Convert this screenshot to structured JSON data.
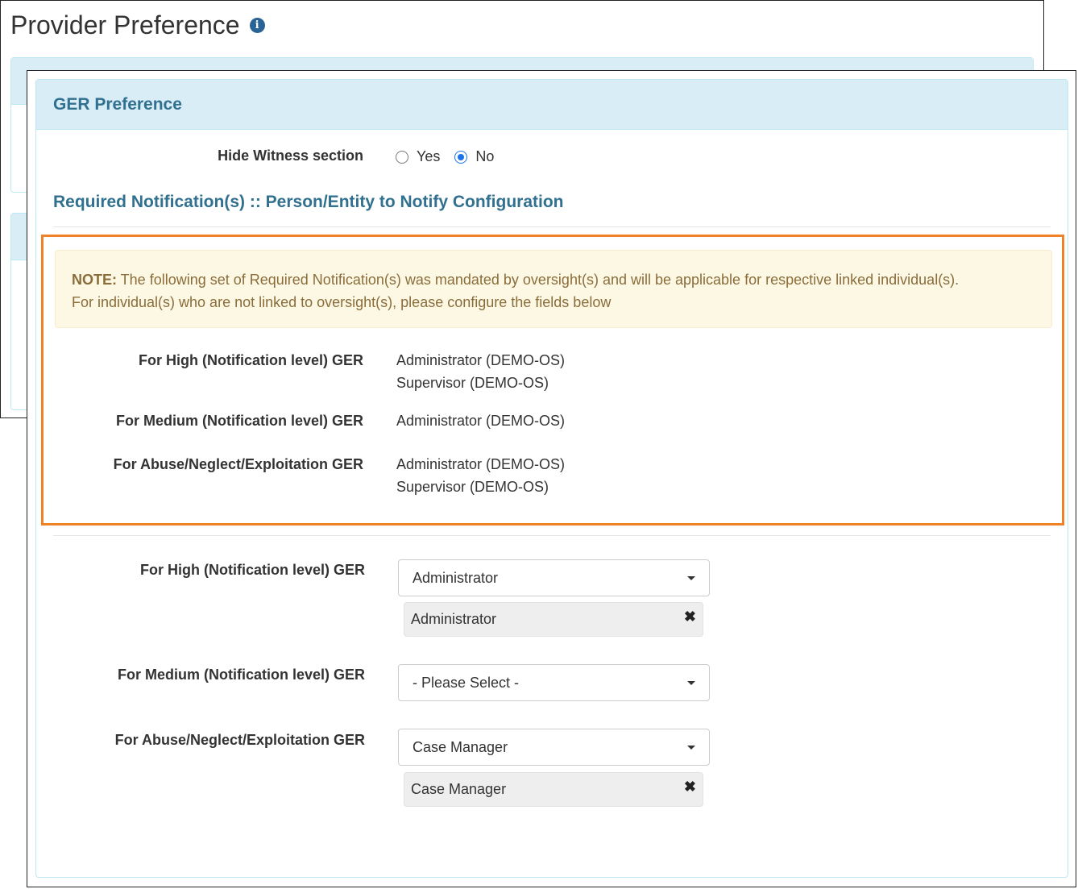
{
  "background": {
    "title": "Provider Preference"
  },
  "panel": {
    "title": "GER Preference"
  },
  "hide_witness": {
    "label": "Hide Witness section",
    "options": [
      "Yes",
      "No"
    ],
    "selected": "No"
  },
  "section_title": "Required Notification(s) :: Person/Entity to Notify Configuration",
  "note": {
    "prefix": "NOTE:",
    "line1": " The following set of Required Notification(s) was mandated by oversight(s) and will be applicable for respective linked individual(s).",
    "line2": "For individual(s) who are not linked to oversight(s), please configure the fields below"
  },
  "mandated": [
    {
      "label": "For High (Notification level) GER",
      "values": [
        "Administrator (DEMO-OS)",
        "Supervisor (DEMO-OS)"
      ]
    },
    {
      "label": "For Medium (Notification level) GER",
      "values": [
        "Administrator (DEMO-OS)"
      ]
    },
    {
      "label": "For Abuse/Neglect/Exploitation GER",
      "values": [
        "Administrator (DEMO-OS)",
        "Supervisor (DEMO-OS)"
      ]
    }
  ],
  "config": [
    {
      "label": "For High (Notification level) GER",
      "selected": "Administrator",
      "tag": "Administrator"
    },
    {
      "label": "For Medium (Notification level) GER",
      "selected": "- Please Select -",
      "tag": null
    },
    {
      "label": "For Abuse/Neglect/Exploitation GER",
      "selected": "Case Manager",
      "tag": "Case Manager"
    }
  ],
  "icons": {
    "info": "info-icon",
    "remove": "close-icon",
    "dropdown": "caret-down-icon"
  },
  "colors": {
    "panel_heading_bg": "#d9edf7",
    "panel_title": "#31708f",
    "note_bg": "#fcf8e3",
    "note_text": "#8a6d3b",
    "highlight_border": "#ef8126",
    "radio_accent": "#1a73e8"
  }
}
